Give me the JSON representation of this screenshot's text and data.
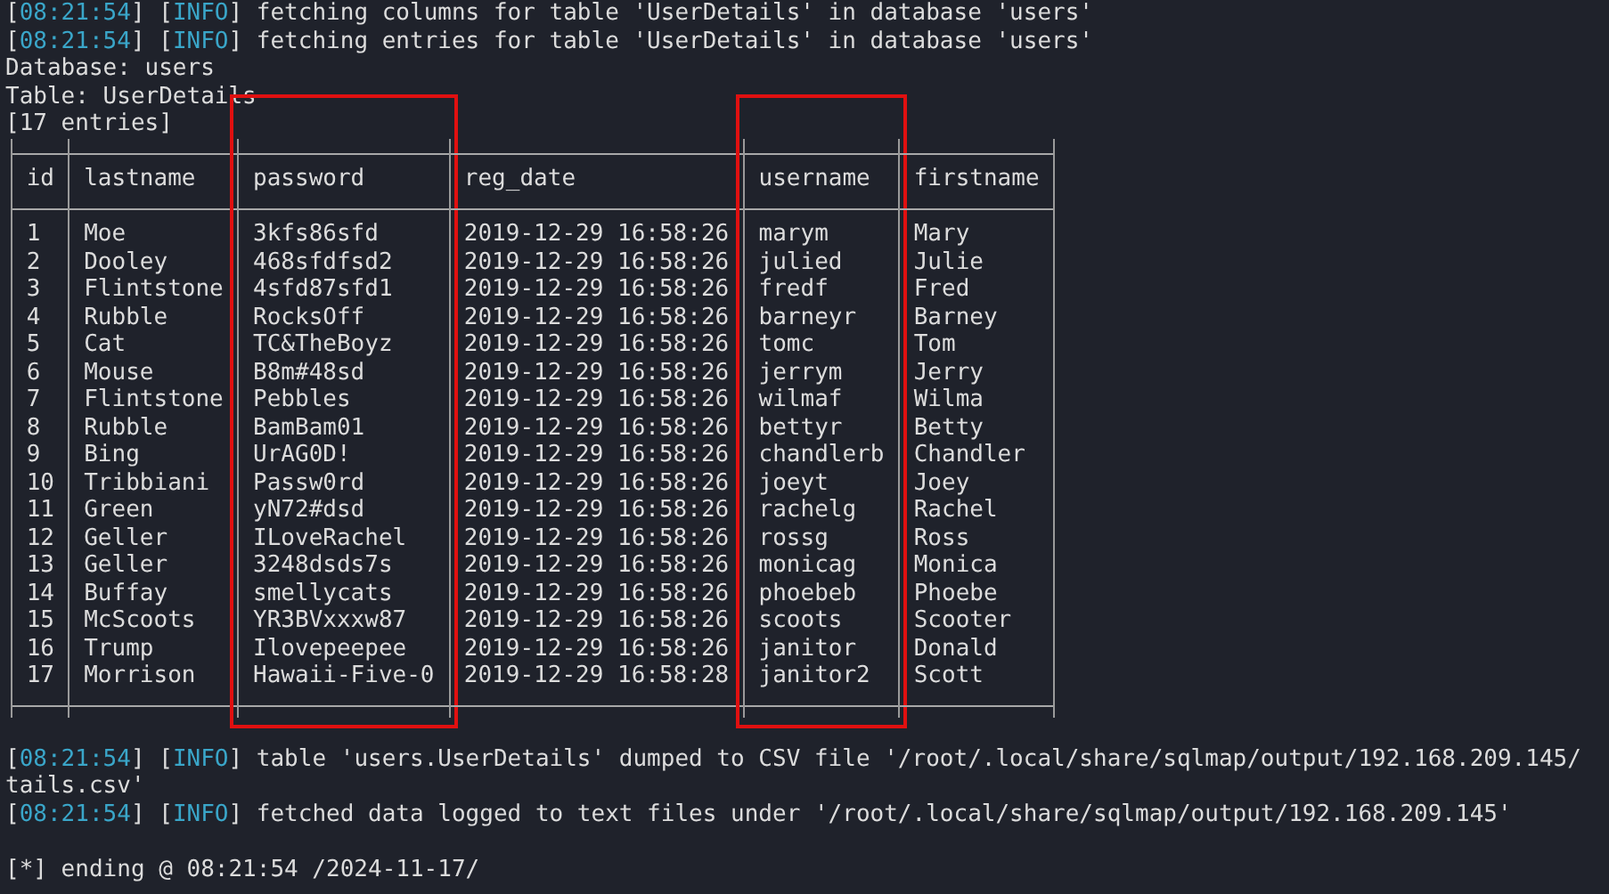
{
  "log_top": [
    {
      "segments": [
        {
          "kind": "punct",
          "text": "["
        },
        {
          "kind": "time",
          "text": "08:21:54"
        },
        {
          "kind": "punct",
          "text": "] ["
        },
        {
          "kind": "level",
          "text": "INFO"
        },
        {
          "kind": "punct",
          "text": "] "
        },
        {
          "kind": "message",
          "text": "fetching columns for table 'UserDetails' in database 'users'"
        }
      ]
    },
    {
      "segments": [
        {
          "kind": "punct",
          "text": "["
        },
        {
          "kind": "time",
          "text": "08:21:54"
        },
        {
          "kind": "punct",
          "text": "] ["
        },
        {
          "kind": "level",
          "text": "INFO"
        },
        {
          "kind": "punct",
          "text": "] "
        },
        {
          "kind": "message",
          "text": "fetching entries for table 'UserDetails' in database 'users'"
        }
      ]
    }
  ],
  "info_lines": [
    "Database: users",
    "Table: UserDetails",
    "[17 entries]"
  ],
  "table": {
    "columns": [
      {
        "name": "id",
        "highlighted": false
      },
      {
        "name": "lastname",
        "highlighted": false
      },
      {
        "name": "password",
        "highlighted": true
      },
      {
        "name": "reg_date",
        "highlighted": false
      },
      {
        "name": "username",
        "highlighted": true
      },
      {
        "name": "firstname",
        "highlighted": false
      }
    ],
    "rows": [
      [
        "1",
        "Moe",
        "3kfs86sfd",
        "2019-12-29 16:58:26",
        "marym",
        "Mary"
      ],
      [
        "2",
        "Dooley",
        "468sfdfsd2",
        "2019-12-29 16:58:26",
        "julied",
        "Julie"
      ],
      [
        "3",
        "Flintstone",
        "4sfd87sfd1",
        "2019-12-29 16:58:26",
        "fredf",
        "Fred"
      ],
      [
        "4",
        "Rubble",
        "RocksOff",
        "2019-12-29 16:58:26",
        "barneyr",
        "Barney"
      ],
      [
        "5",
        "Cat",
        "TC&TheBoyz",
        "2019-12-29 16:58:26",
        "tomc",
        "Tom"
      ],
      [
        "6",
        "Mouse",
        "B8m#48sd",
        "2019-12-29 16:58:26",
        "jerrym",
        "Jerry"
      ],
      [
        "7",
        "Flintstone",
        "Pebbles",
        "2019-12-29 16:58:26",
        "wilmaf",
        "Wilma"
      ],
      [
        "8",
        "Rubble",
        "BamBam01",
        "2019-12-29 16:58:26",
        "bettyr",
        "Betty"
      ],
      [
        "9",
        "Bing",
        "UrAG0D!",
        "2019-12-29 16:58:26",
        "chandlerb",
        "Chandler"
      ],
      [
        "10",
        "Tribbiani",
        "Passw0rd",
        "2019-12-29 16:58:26",
        "joeyt",
        "Joey"
      ],
      [
        "11",
        "Green",
        "yN72#dsd",
        "2019-12-29 16:58:26",
        "rachelg",
        "Rachel"
      ],
      [
        "12",
        "Geller",
        "ILoveRachel",
        "2019-12-29 16:58:26",
        "rossg",
        "Ross"
      ],
      [
        "13",
        "Geller",
        "3248dsds7s",
        "2019-12-29 16:58:26",
        "monicag",
        "Monica"
      ],
      [
        "14",
        "Buffay",
        "smellycats",
        "2019-12-29 16:58:26",
        "phoebeb",
        "Phoebe"
      ],
      [
        "15",
        "McScoots",
        "YR3BVxxxw87",
        "2019-12-29 16:58:26",
        "scoots",
        "Scooter"
      ],
      [
        "16",
        "Trump",
        "Ilovepeepee",
        "2019-12-29 16:58:26",
        "janitor",
        "Donald"
      ],
      [
        "17",
        "Morrison",
        "Hawaii-Five-0",
        "2019-12-29 16:58:28",
        "janitor2",
        "Scott"
      ]
    ]
  },
  "log_bottom": [
    {
      "segments": [
        {
          "kind": "punct",
          "text": "["
        },
        {
          "kind": "time",
          "text": "08:21:54"
        },
        {
          "kind": "punct",
          "text": "] ["
        },
        {
          "kind": "level",
          "text": "INFO"
        },
        {
          "kind": "punct",
          "text": "] "
        },
        {
          "kind": "message",
          "text": "table 'users.UserDetails' dumped to CSV file '/root/.local/share/sqlmap/output/192.168.209.145/"
        }
      ],
      "continuation": "tails.csv'"
    },
    {
      "segments": [
        {
          "kind": "punct",
          "text": "["
        },
        {
          "kind": "time",
          "text": "08:21:54"
        },
        {
          "kind": "punct",
          "text": "] ["
        },
        {
          "kind": "level",
          "text": "INFO"
        },
        {
          "kind": "punct",
          "text": "] "
        },
        {
          "kind": "message",
          "text": "fetched data logged to text files under '/root/.local/share/sqlmap/output/192.168.209.145'"
        }
      ]
    }
  ],
  "footer": "[*] ending @ 08:21:54 /2024-11-17/"
}
